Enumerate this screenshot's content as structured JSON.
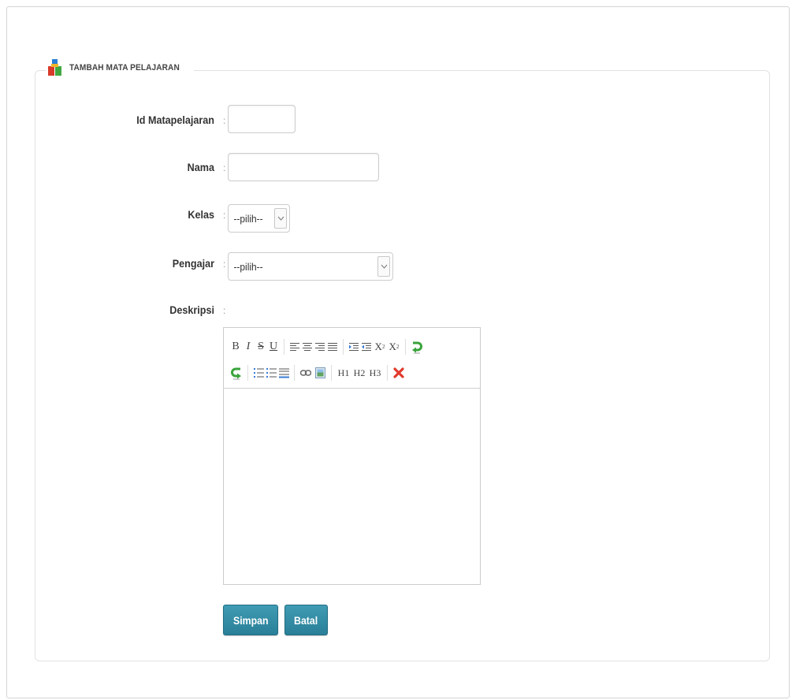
{
  "form": {
    "title": "TAMBAH MATA PELAJARAN",
    "fields": {
      "id": {
        "label": "Id Matapelajaran",
        "value": ""
      },
      "nama": {
        "label": "Nama",
        "value": ""
      },
      "kelas": {
        "label": "Kelas",
        "selected": "--pilih--"
      },
      "pengajar": {
        "label": "Pengajar",
        "selected": "--pilih--"
      },
      "deskripsi": {
        "label": "Deskripsi",
        "value": ""
      }
    },
    "colon": ":",
    "toolbar": {
      "bold": "B",
      "italic": "I",
      "strike": "S",
      "underline": "U",
      "subscript_base": "X",
      "subscript_mark": "2",
      "superscript_base": "X",
      "superscript_mark": "2",
      "h1": "H1",
      "h2": "H2",
      "h3": "H3"
    },
    "buttons": {
      "save": "Simpan",
      "cancel": "Batal"
    }
  },
  "colors": {
    "button": "#2a7f98",
    "remove_format": "#e03b2c",
    "undo_redo": "#3aa33a"
  }
}
